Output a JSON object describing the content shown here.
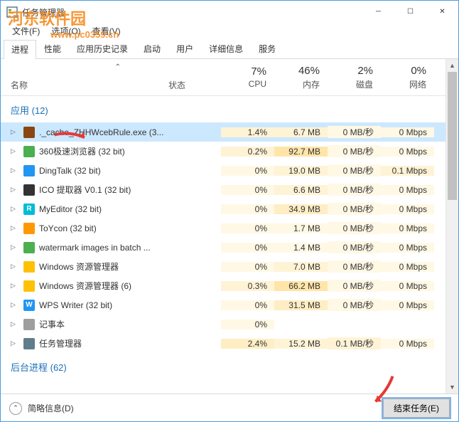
{
  "watermark": {
    "text": "河东软件园",
    "url": "www.pc0359.cn"
  },
  "window": {
    "title": "任务管理器"
  },
  "menu": {
    "file": "文件(F)",
    "options": "选项(O)",
    "view": "查看(V)"
  },
  "tabs": [
    "进程",
    "性能",
    "应用历史记录",
    "启动",
    "用户",
    "详细信息",
    "服务"
  ],
  "columns": {
    "name": "名称",
    "status": "状态",
    "cpu": {
      "pct": "7%",
      "label": "CPU"
    },
    "mem": {
      "pct": "46%",
      "label": "内存"
    },
    "disk": {
      "pct": "2%",
      "label": "磁盘"
    },
    "net": {
      "pct": "0%",
      "label": "网络"
    }
  },
  "groups": {
    "apps": "应用 (12)",
    "bg": "后台进程 (62)"
  },
  "processes": [
    {
      "name": "._cache_ZHHWcebRule.exe (3...",
      "cpu": "1.4%",
      "mem": "6.7 MB",
      "disk": "0 MB/秒",
      "net": "0 Mbps",
      "iconBg": "#8b4513",
      "selected": true,
      "heat": [
        1,
        1,
        0,
        0
      ]
    },
    {
      "name": "360极速浏览器 (32 bit)",
      "cpu": "0.2%",
      "mem": "92.7 MB",
      "disk": "0 MB/秒",
      "net": "0 Mbps",
      "iconBg": "#4caf50",
      "heat": [
        1,
        3,
        0,
        0
      ]
    },
    {
      "name": "DingTalk (32 bit)",
      "cpu": "0%",
      "mem": "19.0 MB",
      "disk": "0 MB/秒",
      "net": "0.1 Mbps",
      "iconBg": "#2196f3",
      "heat": [
        0,
        1,
        0,
        1
      ]
    },
    {
      "name": "ICO 提取器 V0.1 (32 bit)",
      "cpu": "0%",
      "mem": "6.6 MB",
      "disk": "0 MB/秒",
      "net": "0 Mbps",
      "iconBg": "#333",
      "heat": [
        0,
        1,
        0,
        0
      ]
    },
    {
      "name": "MyEditor (32 bit)",
      "cpu": "0%",
      "mem": "34.9 MB",
      "disk": "0 MB/秒",
      "net": "0 Mbps",
      "iconBg": "#00bcd4",
      "iconText": "R",
      "heat": [
        0,
        2,
        0,
        0
      ]
    },
    {
      "name": "ToYcon (32 bit)",
      "cpu": "0%",
      "mem": "1.7 MB",
      "disk": "0 MB/秒",
      "net": "0 Mbps",
      "iconBg": "#ff9800",
      "heat": [
        0,
        0,
        0,
        0
      ]
    },
    {
      "name": "watermark images in batch ...",
      "cpu": "0%",
      "mem": "1.4 MB",
      "disk": "0 MB/秒",
      "net": "0 Mbps",
      "iconBg": "#4caf50",
      "heat": [
        0,
        0,
        0,
        0
      ]
    },
    {
      "name": "Windows 资源管理器",
      "cpu": "0%",
      "mem": "7.0 MB",
      "disk": "0 MB/秒",
      "net": "0 Mbps",
      "iconBg": "#ffc107",
      "heat": [
        0,
        1,
        0,
        0
      ]
    },
    {
      "name": "Windows 资源管理器 (6)",
      "cpu": "0.3%",
      "mem": "66.2 MB",
      "disk": "0 MB/秒",
      "net": "0 Mbps",
      "iconBg": "#ffc107",
      "heat": [
        1,
        3,
        0,
        0
      ]
    },
    {
      "name": "WPS Writer (32 bit)",
      "cpu": "0%",
      "mem": "31.5 MB",
      "disk": "0 MB/秒",
      "net": "0 Mbps",
      "iconBg": "#2196f3",
      "iconText": "W",
      "heat": [
        0,
        2,
        0,
        0
      ]
    },
    {
      "name": "记事本",
      "cpu": "0%",
      "mem": "",
      "disk": "",
      "net": "",
      "iconBg": "#9e9e9e",
      "heat": [
        0,
        0,
        0,
        0
      ]
    },
    {
      "name": "任务管理器",
      "cpu": "2.4%",
      "mem": "15.2 MB",
      "disk": "0.1 MB/秒",
      "net": "0 Mbps",
      "iconBg": "#607d8b",
      "heat": [
        2,
        1,
        1,
        0
      ]
    }
  ],
  "footer": {
    "fewer": "简略信息(D)",
    "endtask": "结束任务(E)"
  }
}
